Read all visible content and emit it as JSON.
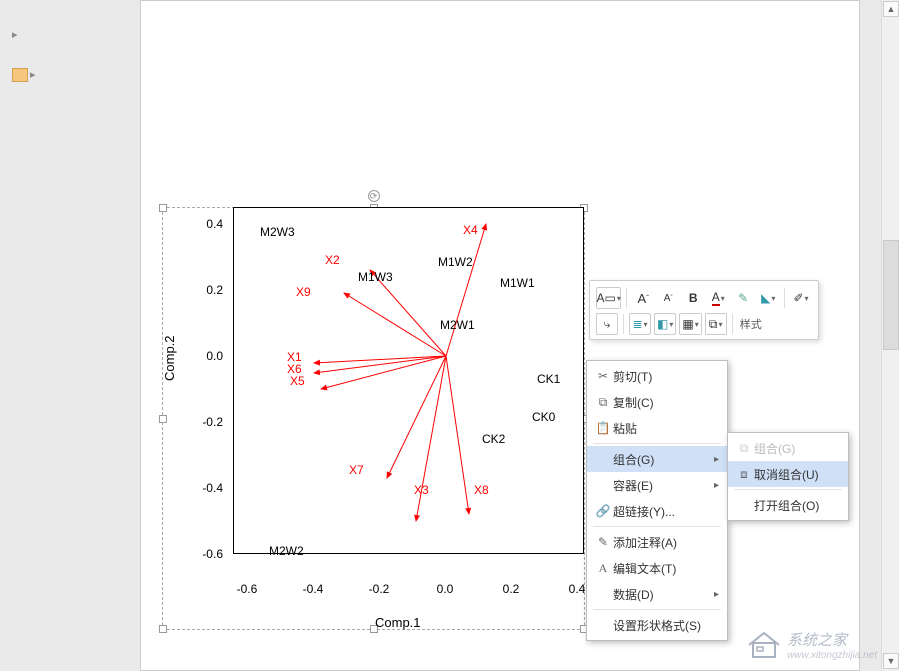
{
  "chart_data": {
    "type": "biplot",
    "title": "",
    "xlabel": "Comp.1",
    "ylabel": "Comp.2",
    "xlim": [
      -0.6,
      0.4
    ],
    "ylim": [
      -0.6,
      0.4
    ],
    "xticks": [
      -0.6,
      -0.4,
      -0.2,
      0.0,
      0.2,
      0.4
    ],
    "yticks": [
      -0.6,
      -0.4,
      -0.2,
      0.0,
      0.2,
      0.4
    ],
    "origin": [
      0.0,
      0.0
    ],
    "loadings": [
      {
        "name": "X1",
        "x": -0.4,
        "y": -0.02
      },
      {
        "name": "X2",
        "x": -0.23,
        "y": 0.26
      },
      {
        "name": "X3",
        "x": -0.09,
        "y": -0.5
      },
      {
        "name": "X4",
        "x": 0.12,
        "y": 0.4
      },
      {
        "name": "X5",
        "x": -0.38,
        "y": -0.1
      },
      {
        "name": "X6",
        "x": -0.4,
        "y": -0.05
      },
      {
        "name": "X7",
        "x": -0.18,
        "y": -0.37
      },
      {
        "name": "X8",
        "x": 0.07,
        "y": -0.48
      },
      {
        "name": "X9",
        "x": -0.31,
        "y": 0.19
      }
    ],
    "scores": [
      {
        "name": "M2W3",
        "x": -0.4,
        "y": 0.4
      },
      {
        "name": "M1W3",
        "x": -0.16,
        "y": 0.23
      },
      {
        "name": "M1W2",
        "x": 0.1,
        "y": 0.27
      },
      {
        "name": "M1W1",
        "x": 0.29,
        "y": 0.22
      },
      {
        "name": "M2W1",
        "x": 0.07,
        "y": 0.08
      },
      {
        "name": "CK1",
        "x": 0.34,
        "y": -0.07
      },
      {
        "name": "CK0",
        "x": 0.32,
        "y": -0.18
      },
      {
        "name": "CK2",
        "x": 0.17,
        "y": -0.32
      },
      {
        "name": "M2W2",
        "x": -0.4,
        "y": -0.6
      }
    ]
  },
  "axis": {
    "x": "Comp.1",
    "y": "Comp.2"
  },
  "ticks": {
    "x": [
      "-0.6",
      "-0.4",
      "-0.2",
      "0.0",
      "0.2",
      "0.4"
    ],
    "y": [
      "-0.6",
      "-0.4",
      "-0.2",
      "0.0",
      "0.2",
      "0.4"
    ]
  },
  "point_labels": {
    "M2W3": "M2W3",
    "M1W3": "M1W3",
    "M1W2": "M1W2",
    "M1W1": "M1W1",
    "M2W1": "M2W1",
    "CK1": "CK1",
    "CK0": "CK0",
    "CK2": "CK2",
    "M2W2": "M2W2",
    "X1": "X1",
    "X2": "X2",
    "X3": "X3",
    "X4": "X4",
    "X5": "X5",
    "X6": "X6",
    "X7": "X7",
    "X8": "X8",
    "X9": "X9"
  },
  "ui": {
    "mini_toolbar": {
      "font_textbox": "A",
      "font_grow": "A↑",
      "font_shrink": "A↓",
      "bold": "B",
      "font_color": "A",
      "fill": " ",
      "shape": " ",
      "styles": "样式",
      "anchor": " ",
      "align": " ",
      "arrange_front": " ",
      "arrange": " ",
      "group": " "
    },
    "ctx": {
      "cut": "剪切(T)",
      "copy": "复制(C)",
      "paste": "粘贴",
      "group": "组合(G)",
      "container": "容器(E)",
      "hyperlink": "超链接(Y)...",
      "comment": "添加注释(A)",
      "edit_text": "编辑文本(T)",
      "data": "数据(D)",
      "shape_format": "设置形状格式(S)"
    },
    "sub": {
      "group": "组合(G)",
      "ungroup": "取消组合(U)",
      "open_group": "打开组合(O)"
    },
    "watermark": {
      "site": "系统之家",
      "url": "www.xitongzhijia.net"
    }
  }
}
